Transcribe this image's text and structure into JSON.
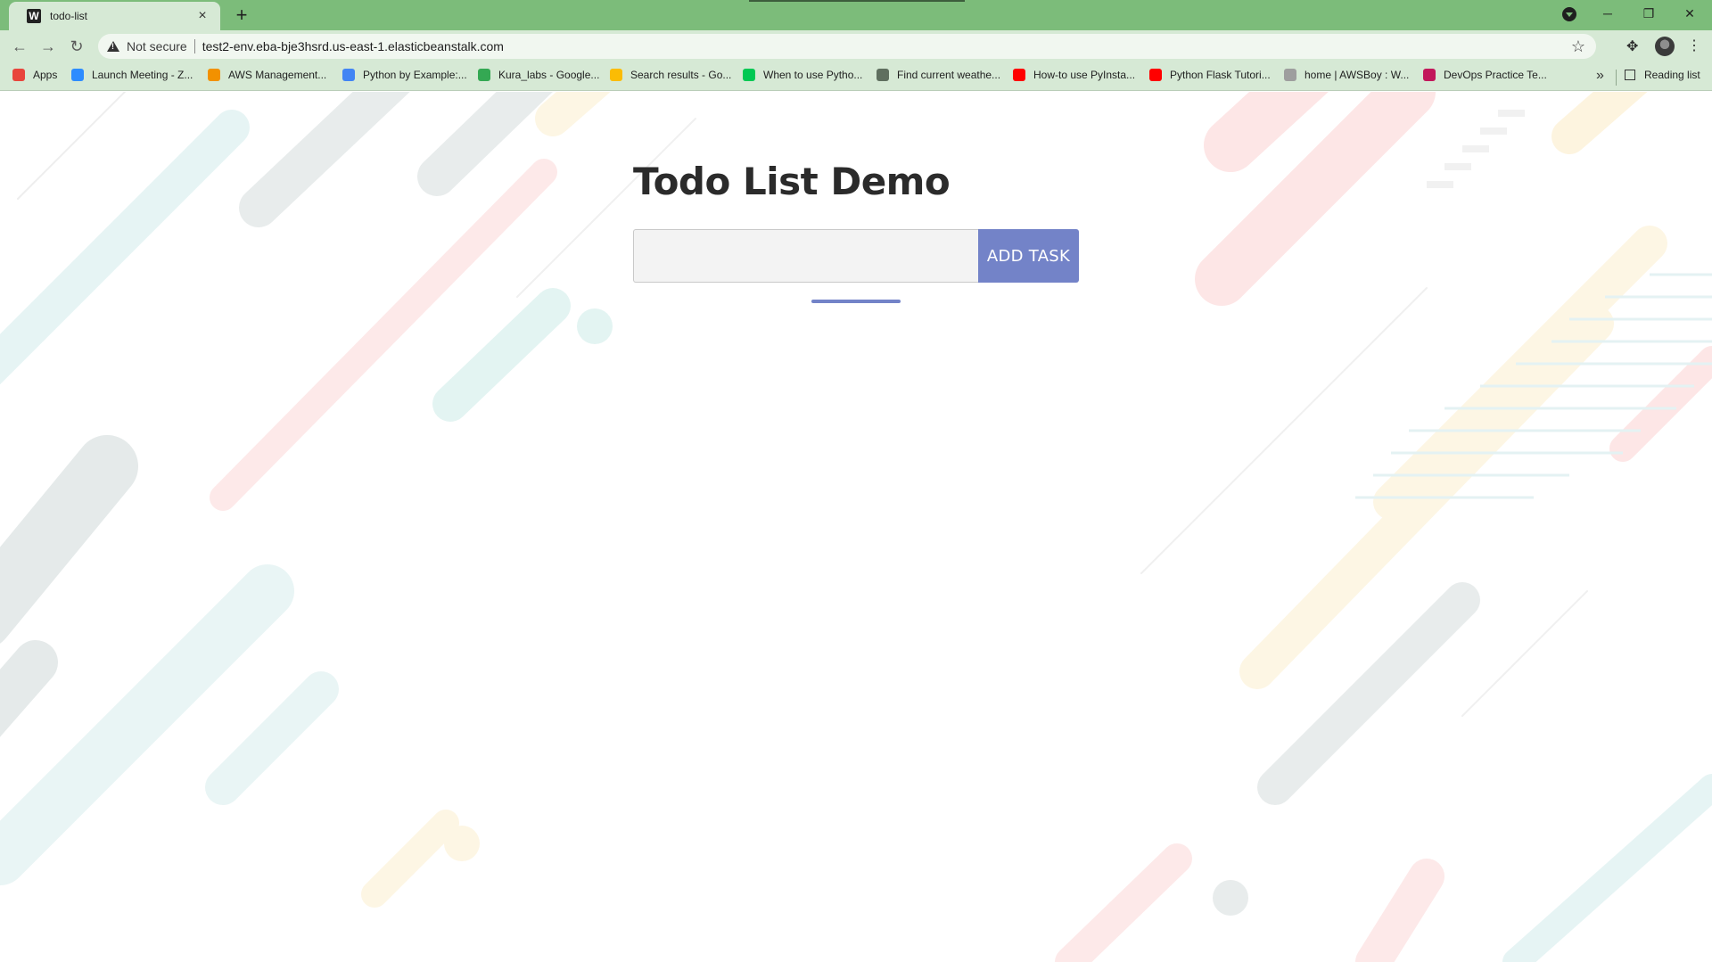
{
  "browser": {
    "tab": {
      "favicon": "W",
      "title": "todo-list"
    },
    "new_tab": "+",
    "address": {
      "security_label": "Not secure",
      "url": "test2-env.eba-bje3hsrd.us-east-1.elasticbeanstalk.com"
    },
    "window_controls": {
      "minimize": "─",
      "restore": "❐",
      "close": "✕"
    },
    "nav": {
      "back": "←",
      "forward": "→",
      "reload": "↻"
    },
    "bookmarks": [
      {
        "label": "Apps",
        "icon": "apps-grid-icon",
        "color": "#e8453c"
      },
      {
        "label": "Launch Meeting - Z...",
        "icon": "zoom-icon",
        "color": "#2d8cff"
      },
      {
        "label": "AWS Management...",
        "icon": "aws-icon",
        "color": "#f29100"
      },
      {
        "label": "Python by Example:...",
        "icon": "google-icon",
        "color": "#4285f4"
      },
      {
        "label": "Kura_labs - Google...",
        "icon": "google-drive-icon",
        "color": "#34a853"
      },
      {
        "label": "Search results - Go...",
        "icon": "google-drive-icon",
        "color": "#fbbc04"
      },
      {
        "label": "When to use Pytho...",
        "icon": "bookmark-icon",
        "color": "#00c853"
      },
      {
        "label": "Find current weathe...",
        "icon": "weather-icon",
        "color": "#5f6f5f"
      },
      {
        "label": "How-to use PyInsta...",
        "icon": "youtube-icon",
        "color": "#ff0000"
      },
      {
        "label": "Python Flask Tutori...",
        "icon": "youtube-icon",
        "color": "#ff0000"
      },
      {
        "label": "home | AWSBoy : W...",
        "icon": "site-icon",
        "color": "#9e9e9e"
      },
      {
        "label": "DevOps Practice Te...",
        "icon": "devops-icon",
        "color": "#c2185b"
      }
    ],
    "bookmarks_overflow": "»",
    "reading_list": "Reading list"
  },
  "app": {
    "title": "Todo List Demo",
    "input_value": "",
    "input_placeholder": "",
    "add_button": "ADD TASK",
    "accent": "#7383c8"
  }
}
